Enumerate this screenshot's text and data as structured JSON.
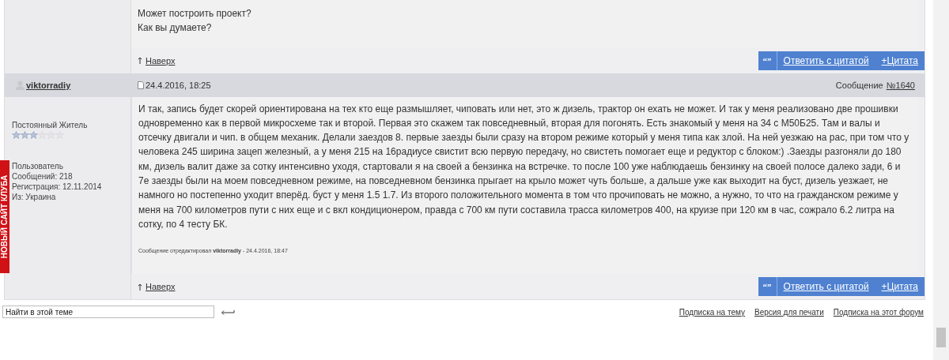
{
  "side_tab": {
    "label": "НОВЫЙ САЙТ КЛУБА"
  },
  "posts": [
    {
      "kind": "tail",
      "body": [
        "Может построить проект?",
        "Как вы думаете?"
      ],
      "top_link": "Наверх",
      "quote_icon": "“”",
      "actions": [
        "Ответить с цитатой",
        "+Цитата"
      ]
    },
    {
      "kind": "full",
      "author": "viktorradiy",
      "date": "24.4.2016, 18:25",
      "number_label": "Сообщение",
      "number": "№1640",
      "rank": "Постоянный Житель",
      "stars": 3,
      "info": [
        "Пользователь",
        "Сообщений: 218",
        "Регистрация: 12.11.2014",
        "Из: Украина"
      ],
      "body": [
        "И так, запись будет скорей ориентирована на тех кто еще размышляет, чиповать или нет, это ж дизель, трактор он ехать не может. И так у меня реализовано две прошивки одновременно как в первой микросхеме так и второй. Первая это скажем так повседневный, вторая для погонять. Есть знакомый у меня на 34 с М50Б25. Там и валы и отсечку двигали и чип. в общем механик. Делали заездов 8. первые заезды были сразу на втором режиме который у меня типа как злой. На ней уезжаю на рас, при том что у человека 245 ширина зацеп железный, а у меня 215 на 16радиусе свистит всю первую передачу, но свистеть помогает еще и редуктор с блоком:) .Заезды разгоняли до 180 км, дизель валит даже за сотку интенсивно уходя, стартовали я на своей а бензинка на встречке. то после 100 уже наблюдаешь бензинку на своей полосе далеко зади, 6 и 7е заезды были на моем повседневном режиме, на повседневном бензинка прыгает на крыло может чуть больше, а дальше уже как выходит на буст, дизель уезжает, не намного но постепенно уходит вперёд. буст у меня 1.5 1.7. Из второго положительного момента в том что прочиповать не можно, а нужно, то что на гражданском режиме у меня на 700 километров пути с них еще и с вкл кондиционером, правда с 700 км пути составила трасса километров 400, на круизе при 120 км в час, сожрало 6.2 литра на сотку, по 4 тесту БК."
      ],
      "edit_note": "Сообщение отредактировал **viktorradiy** - 24.4.2016, 18:47",
      "top_link": "Наверх",
      "quote_icon": "“”",
      "actions": [
        "Ответить с цитатой",
        "+Цитата"
      ]
    }
  ],
  "search": {
    "value": "Найти в этой теме"
  },
  "footer_links": [
    "Подписка на тему",
    "Версия для печати",
    "Подписка на этот форум"
  ]
}
